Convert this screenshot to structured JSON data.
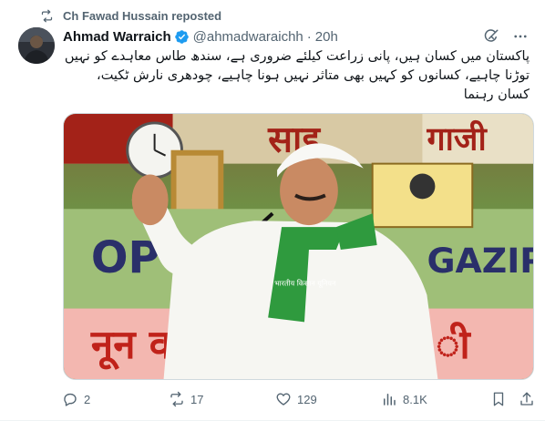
{
  "repost": {
    "text": "Ch Fawad Hussain reposted"
  },
  "author": {
    "name": "Ahmad Warraich",
    "handle": "@ahmadwaraichh",
    "separator": "·",
    "time": "20h"
  },
  "tweet": {
    "text": "پاکستان میں کسان ہیں، پانی زراعت کیلئے ضروری ہے، سندھ طاس معاہدے کو نہیں توڑنا چاہیے، کسانوں کو کہیں بھی متاثر نہیں ہونا چاہیے، چودھری نارش ٹکیت، کسان رہنما"
  },
  "media": {
    "banner_left": "साइ",
    "banner_right": "गाजी",
    "sign_left": "OP",
    "sign_right": "GAZIP",
    "bottom_text": "नून वा",
    "bottom_text_right": "ी",
    "scarf_text": "भारतीय किसान यूनियन"
  },
  "actions": {
    "replies": "2",
    "reposts": "17",
    "likes": "129",
    "views": "8.1K"
  },
  "icons": {
    "repost": "repost-icon",
    "verified": "verified-badge-icon",
    "grok": "grok-icon",
    "more": "more-icon",
    "reply": "reply-icon",
    "like": "like-icon",
    "views": "views-icon",
    "bookmark": "bookmark-icon",
    "share": "share-icon"
  },
  "colors": {
    "text": "#0f1419",
    "secondary": "#536471",
    "verified": "#1d9bf0",
    "border": "#cfd9de"
  }
}
